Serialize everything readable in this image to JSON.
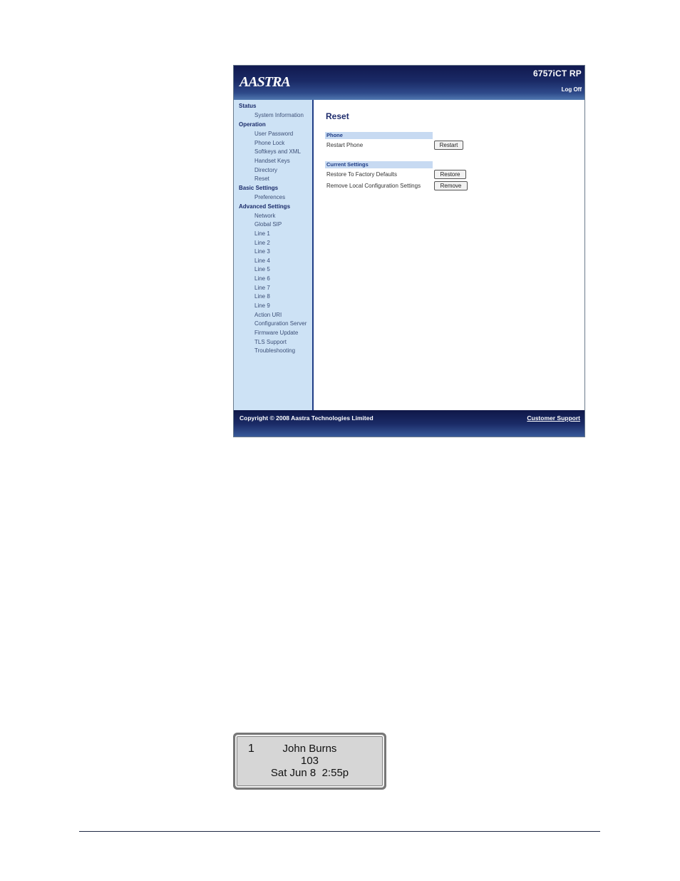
{
  "header": {
    "logo": "AASTRA",
    "model": "6757iCT RP",
    "logoff": "Log Off"
  },
  "sidebar": {
    "status": {
      "label": "Status",
      "items": [
        "System Information"
      ]
    },
    "operation": {
      "label": "Operation",
      "items": [
        "User Password",
        "Phone Lock",
        "Softkeys and XML",
        "Handset Keys",
        "Directory",
        "Reset"
      ]
    },
    "basic": {
      "label": "Basic Settings",
      "items": [
        "Preferences"
      ]
    },
    "advanced": {
      "label": "Advanced Settings",
      "items": [
        "Network",
        "Global SIP",
        "Line 1",
        "Line 2",
        "Line 3",
        "Line 4",
        "Line 5",
        "Line 6",
        "Line 7",
        "Line 8",
        "Line 9",
        "Action URI",
        "Configuration Server",
        "Firmware Update",
        "TLS Support",
        "Troubleshooting"
      ]
    }
  },
  "main": {
    "title": "Reset",
    "phone_section": "Phone",
    "restart_label": "Restart Phone",
    "restart_button": "Restart",
    "current_section": "Current Settings",
    "restore_label": "Restore To Factory Defaults",
    "restore_button": "Restore",
    "remove_label": "Remove Local Configuration Settings",
    "remove_button": "Remove"
  },
  "footer": {
    "copyright": "Copyright © 2008 Aastra Technologies Limited",
    "support": "Customer Support"
  },
  "phone_display": {
    "line": "1",
    "name": "John Burns",
    "ext": "103",
    "datetime": "Sat Jun 8  2:55p"
  }
}
